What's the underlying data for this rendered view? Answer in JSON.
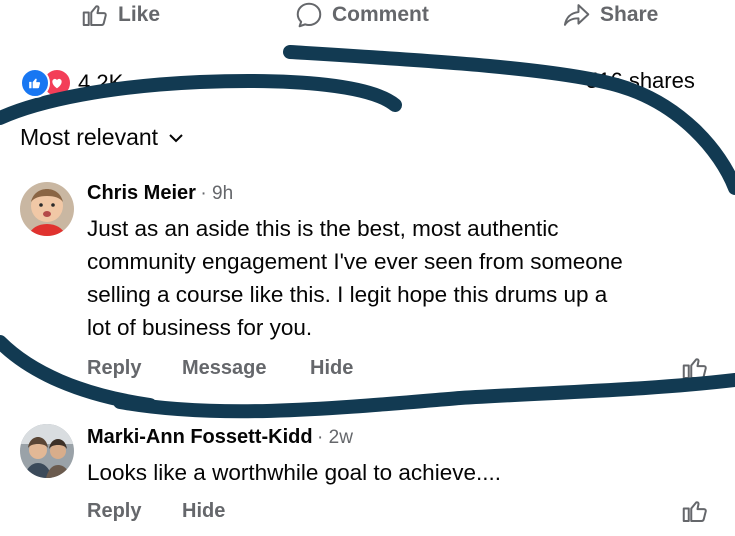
{
  "actions": {
    "like": "Like",
    "comment": "Comment",
    "share": "Share"
  },
  "reactions": {
    "count": "4.2K",
    "shares": "516 shares"
  },
  "sort": {
    "label": "Most relevant"
  },
  "comments": [
    {
      "author": "Chris Meier",
      "time": "9h",
      "text_lines": [
        "Just as an aside this is the best, most authentic",
        "community engagement I've ever seen from someone",
        "selling a course like this. I legit hope this drums up a",
        "lot of business for you."
      ],
      "reply": "Reply",
      "message": "Message",
      "hide": "Hide"
    },
    {
      "author": "Marki-Ann Fossett-Kidd",
      "time": "2w",
      "text": "Looks like a worthwhile goal to achieve....",
      "reply": "Reply",
      "hide": "Hide"
    }
  ],
  "colors": {
    "marker": "#123a52",
    "like_blue": "#1877f2",
    "love_red": "#f33e58",
    "secondary_text": "#65676b"
  }
}
